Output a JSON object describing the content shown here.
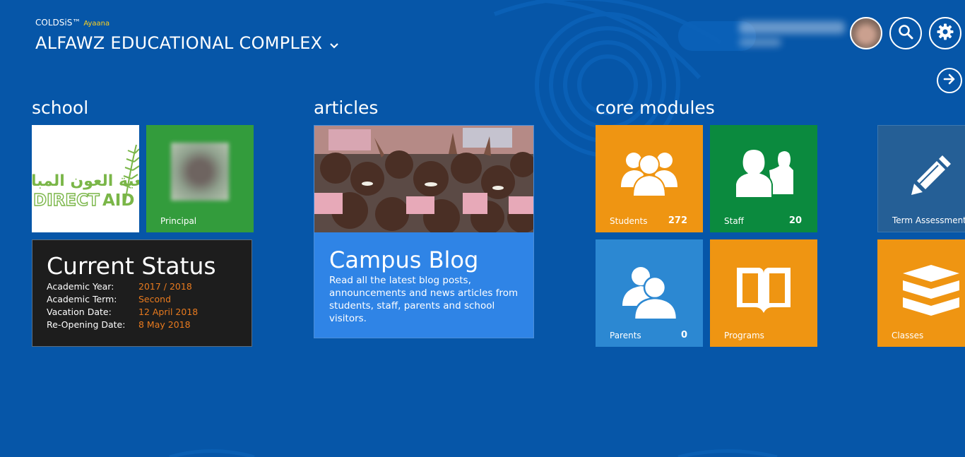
{
  "header": {
    "brand": "COLDSiS™",
    "brand_sub": "Ayaana",
    "org_name": "ALFAWZ EDUCATIONAL COMPLEX",
    "org_chevron": "⌄"
  },
  "sections": {
    "school": "school",
    "articles": "articles",
    "core": "core modules"
  },
  "school": {
    "logo_arabic": "جمعية العون المباشر",
    "logo_direct": "DIRECT",
    "logo_aid": "AID",
    "principal_label": "Principal"
  },
  "status": {
    "title": "Current Status",
    "rows": [
      {
        "key": "Academic Year:",
        "value": "2017 / 2018"
      },
      {
        "key": "Academic Term:",
        "value": "Second"
      },
      {
        "key": "Vacation Date:",
        "value": "12 April 2018"
      },
      {
        "key": "Re-Opening Date:",
        "value": "8 May 2018"
      }
    ]
  },
  "blog": {
    "title": "Campus Blog",
    "description": "Read all the latest blog posts, announcements and news articles from students, staff, parents and school visitors."
  },
  "modules": {
    "students": {
      "label": "Students",
      "count": "272"
    },
    "staff": {
      "label": "Staff",
      "count": "20"
    },
    "term": {
      "label": "Term Assessments"
    },
    "parents": {
      "label": "Parents",
      "count": "0"
    },
    "programs": {
      "label": "Programs"
    },
    "classes": {
      "label": "Classes"
    }
  },
  "colors": {
    "background": "#0656a8",
    "orange": "#ef9512",
    "green": "#0b8a3e",
    "blue_tile": "#2f84e6",
    "status_value": "#e87a1e"
  },
  "icons": [
    "search-icon",
    "gear-icon",
    "arrow-right-icon",
    "users-group-icon",
    "staff-icon",
    "pencil-icon",
    "parents-icon",
    "book-icon",
    "layers-icon"
  ]
}
